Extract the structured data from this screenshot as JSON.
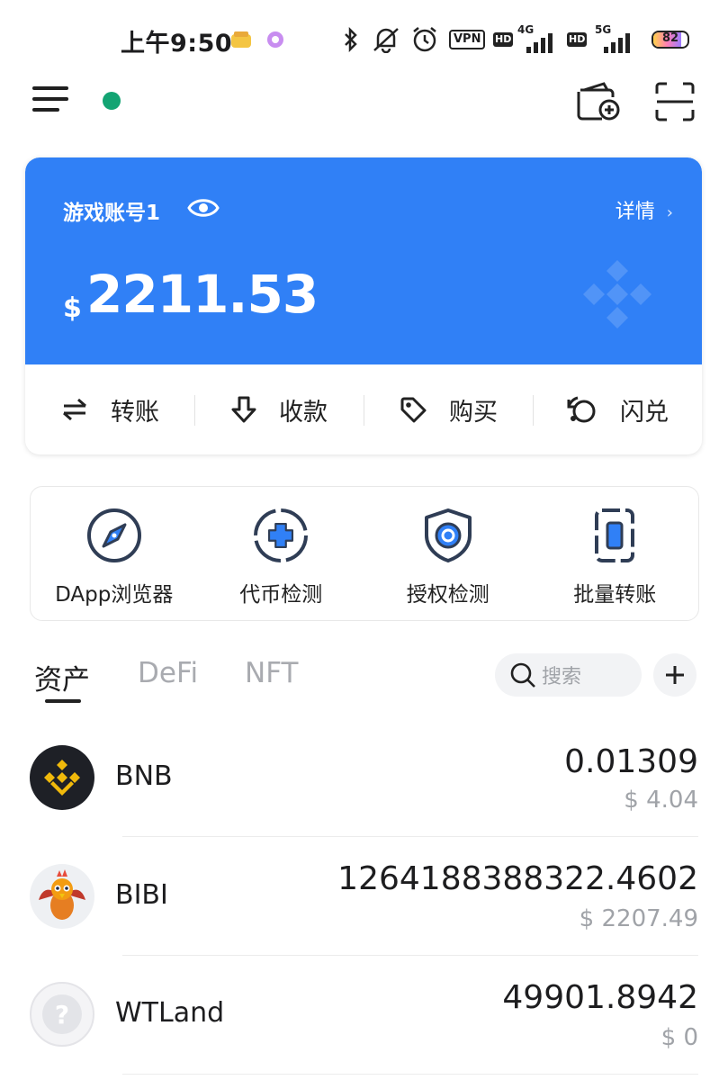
{
  "status_bar": {
    "time": "上午9:50",
    "vpn": "VPN",
    "hd1": "HD",
    "net1": "4G",
    "hd2": "HD",
    "net2": "5G",
    "battery": "82"
  },
  "account": {
    "name": "游戏账号1",
    "detail_label": "详情",
    "currency_symbol": "$",
    "balance": "2211.53"
  },
  "actions": [
    {
      "label": "转账",
      "icon": "transfer-icon"
    },
    {
      "label": "收款",
      "icon": "receive-icon"
    },
    {
      "label": "购买",
      "icon": "buy-tag-icon"
    },
    {
      "label": "闪兑",
      "icon": "swap-icon"
    }
  ],
  "tools": [
    {
      "label": "DApp浏览器",
      "icon": "compass-icon"
    },
    {
      "label": "代币检测",
      "icon": "token-check-icon"
    },
    {
      "label": "授权检测",
      "icon": "shield-icon"
    },
    {
      "label": "批量转账",
      "icon": "batch-transfer-icon"
    }
  ],
  "tabs": [
    "资产",
    "DeFi",
    "NFT"
  ],
  "search": {
    "placeholder": "搜索"
  },
  "assets": [
    {
      "symbol": "BNB",
      "amount": "0.01309",
      "usd": "$ 4.04"
    },
    {
      "symbol": "BIBI",
      "amount": "1264188388322.4602",
      "usd": "$ 2207.49"
    },
    {
      "symbol": "WTLand",
      "amount": "49901.8942",
      "usd": "$ 0"
    }
  ],
  "colors": {
    "card_blue": "#3080f6",
    "online_green": "#13a473",
    "bnb_yellow": "#f0b90b"
  }
}
